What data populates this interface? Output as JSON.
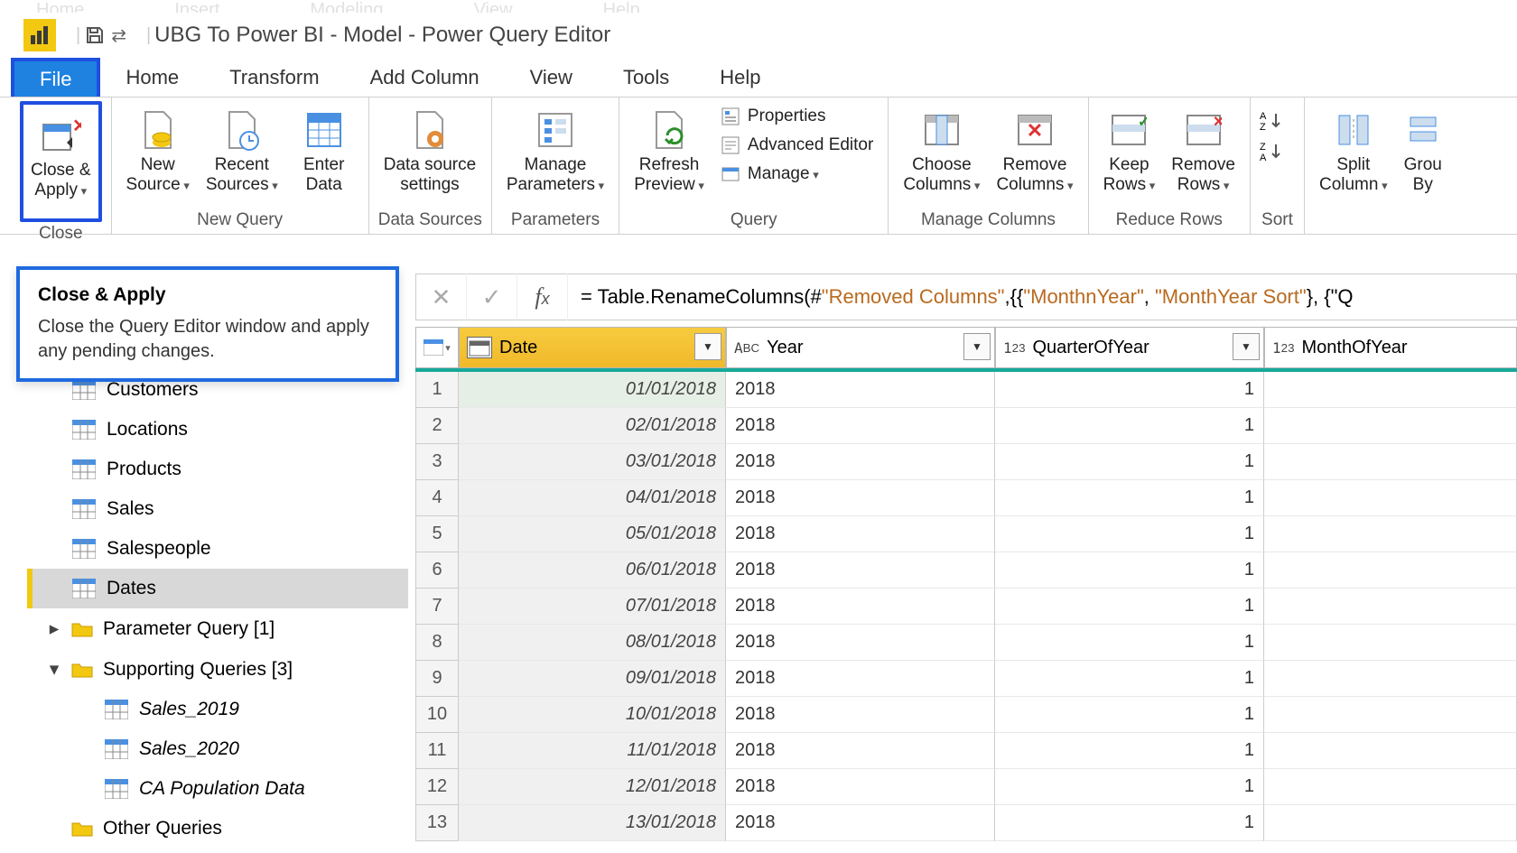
{
  "title": "UBG To Power BI - Model - Power Query Editor",
  "tabs": [
    "File",
    "Home",
    "Transform",
    "Add Column",
    "View",
    "Tools",
    "Help"
  ],
  "ribbon": {
    "close_group": "Close",
    "close_apply": "Close &\nApply",
    "new_query_group": "New Query",
    "new_source": "New\nSource",
    "recent_sources": "Recent\nSources",
    "enter_data": "Enter\nData",
    "data_sources_group": "Data Sources",
    "data_source_settings": "Data source\nsettings",
    "parameters_group": "Parameters",
    "manage_parameters": "Manage\nParameters",
    "query_group": "Query",
    "refresh_preview": "Refresh\nPreview",
    "properties": "Properties",
    "advanced_editor": "Advanced Editor",
    "manage": "Manage",
    "manage_columns_group": "Manage Columns",
    "choose_columns": "Choose\nColumns",
    "remove_columns": "Remove\nColumns",
    "reduce_rows_group": "Reduce Rows",
    "keep_rows": "Keep\nRows",
    "remove_rows": "Remove\nRows",
    "sort_group": "Sort",
    "split_column": "Split\nColumn",
    "group_by": "Grou\nBy"
  },
  "tooltip": {
    "title": "Close & Apply",
    "body": "Close the Query Editor window and apply any pending changes."
  },
  "queries": {
    "items": [
      "Customers",
      "Locations",
      "Products",
      "Sales",
      "Salespeople",
      "Dates"
    ],
    "folders": [
      {
        "name": "Parameter Query [1]",
        "expanded": false
      },
      {
        "name": "Supporting Queries [3]",
        "expanded": true,
        "children": [
          "Sales_2019",
          "Sales_2020",
          "CA Population Data"
        ]
      },
      {
        "name": "Other Queries",
        "expanded": false,
        "noarrow": true
      }
    ],
    "selected": "Dates"
  },
  "formula": {
    "prefix": "= Table.RenameColumns(#",
    "s1": "\"Removed Columns\"",
    "mid": ",{{",
    "s2": "\"MonthnYear\"",
    "c1": ", ",
    "s3": "\"MonthYear Sort\"",
    "tail": "}, {\"Q"
  },
  "columns": [
    "Date",
    "Year",
    "QuarterOfYear",
    "MonthOfYear"
  ],
  "rows": [
    {
      "n": 1,
      "date": "01/01/2018",
      "year": "2018",
      "q": "1"
    },
    {
      "n": 2,
      "date": "02/01/2018",
      "year": "2018",
      "q": "1"
    },
    {
      "n": 3,
      "date": "03/01/2018",
      "year": "2018",
      "q": "1"
    },
    {
      "n": 4,
      "date": "04/01/2018",
      "year": "2018",
      "q": "1"
    },
    {
      "n": 5,
      "date": "05/01/2018",
      "year": "2018",
      "q": "1"
    },
    {
      "n": 6,
      "date": "06/01/2018",
      "year": "2018",
      "q": "1"
    },
    {
      "n": 7,
      "date": "07/01/2018",
      "year": "2018",
      "q": "1"
    },
    {
      "n": 8,
      "date": "08/01/2018",
      "year": "2018",
      "q": "1"
    },
    {
      "n": 9,
      "date": "09/01/2018",
      "year": "2018",
      "q": "1"
    },
    {
      "n": 10,
      "date": "10/01/2018",
      "year": "2018",
      "q": "1"
    },
    {
      "n": 11,
      "date": "11/01/2018",
      "year": "2018",
      "q": "1"
    },
    {
      "n": 12,
      "date": "12/01/2018",
      "year": "2018",
      "q": "1"
    },
    {
      "n": 13,
      "date": "13/01/2018",
      "year": "2018",
      "q": "1"
    }
  ]
}
